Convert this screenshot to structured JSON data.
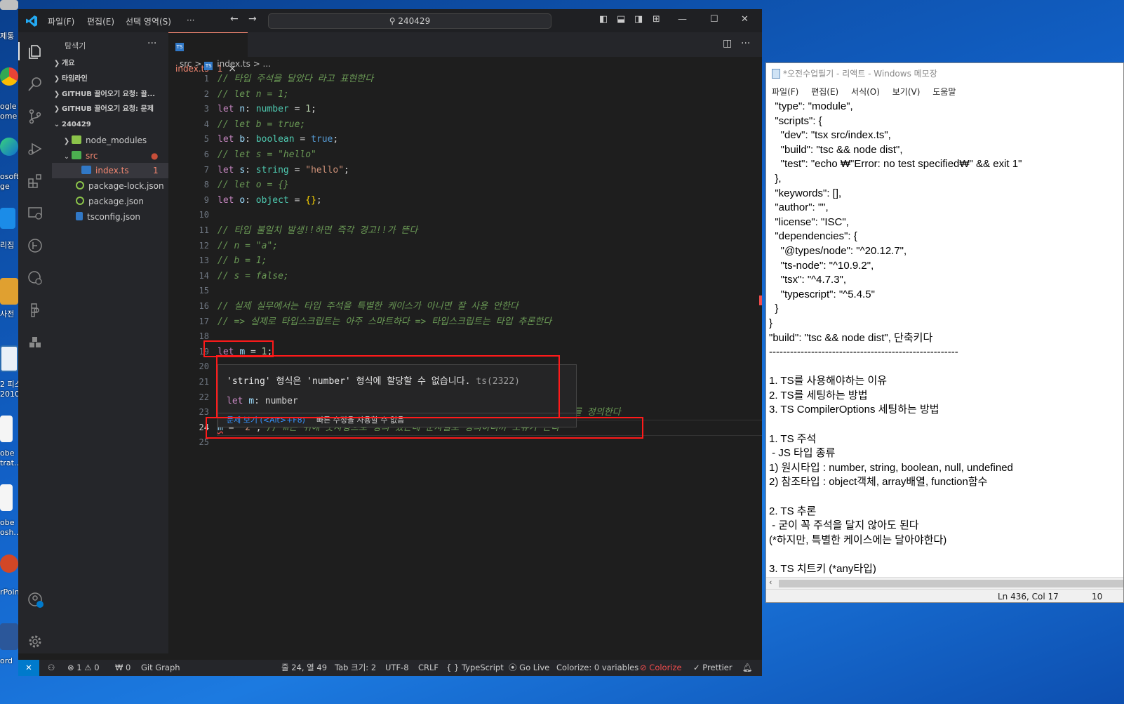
{
  "desktop": {
    "labels": [
      "제통",
      "ogle",
      "ome",
      "osoft",
      "ge",
      "리집",
      "사전",
      "2 피스",
      "2010",
      "obe",
      "trat...",
      "obe",
      "osh...",
      "rPoin",
      "ord"
    ]
  },
  "vscode": {
    "menu": [
      "파일(F)",
      "편집(E)",
      "선택 영역(S)",
      "···"
    ],
    "command_center": "240429",
    "sidebar": {
      "title": "탐색기",
      "sections": [
        "개요",
        "타임라인",
        "GITHUB 끌어오기 요청: 끌...",
        "GITHUB 끌어오기 요청: 문제",
        "240429"
      ],
      "files": [
        "node_modules",
        "src",
        "index.ts",
        "package-lock.json",
        "package.json",
        "tsconfig.json"
      ],
      "badge": "1"
    },
    "tab": {
      "label": "index.ts",
      "badge": "1",
      "close": "×"
    },
    "breadcrumb": [
      "src",
      ">",
      "index.ts",
      "> ..."
    ],
    "line_numbers": [
      "1",
      "2",
      "3",
      "4",
      "5",
      "6",
      "7",
      "8",
      "9",
      "10",
      "11",
      "12",
      "13",
      "14",
      "15",
      "16",
      "17",
      "18",
      "19",
      "20",
      "21",
      "22",
      "23",
      "24",
      "25"
    ],
    "code": {
      "l1": "// 타입 주석을 달았다 라고 표현한다",
      "l2": "// let n = 1;",
      "l3": {
        "kw": "let",
        "var": "n",
        "colon": ":",
        "type": "number",
        "eq": " = ",
        "val": "1",
        "end": ";"
      },
      "l4": "// let b = true;",
      "l5": {
        "kw": "let",
        "var": "b",
        "colon": ":",
        "type": "boolean",
        "eq": " = ",
        "val": "true",
        "end": ";"
      },
      "l6": "// let s = \"hello\"",
      "l7": {
        "kw": "let",
        "var": "s",
        "colon": ":",
        "type": "string",
        "eq": " = ",
        "val": "\"hello\"",
        "end": ";"
      },
      "l8": "// let o = {}",
      "l9": {
        "kw": "let",
        "var": "o",
        "colon": ":",
        "type": "object",
        "eq": " = ",
        "val": "{}",
        "end": ";"
      },
      "l11": "// 타입 불일치 발생!!하면 즉각 경고!!가 뜬다",
      "l12": "// n = \"a\";",
      "l13": "// b = 1;",
      "l14": "// s = false;",
      "l16": "// 실제 실무에서는 타입 주석을 특별한 케이스가 아니면 잘 사용 안한다",
      "l17": "// => 실제로 타입스크립트는 아주 스마트하다 => 타입스크립트는 타입 추론한다",
      "l19": {
        "kw": "let",
        "var": "m",
        "eq": " = ",
        "val": "1",
        "end": ";"
      },
      "l23_tail": "를 정의한다",
      "l24": {
        "var": "m",
        "eq": " = ",
        "str": "\"2\"",
        "end": "; ",
        "comment": "// m은 위에 숫자형으로 정의 했는데 문자열로 정의하니까 오류가 뜬다"
      }
    },
    "hover": {
      "message": "'string' 형식은 'number' 형식에 할당할 수 없습니다.",
      "code": "ts(2322)",
      "sig_kw": "let",
      "sig_var": "m",
      "sig_type": ": number",
      "view_problem": "문제 보기 (<Alt>+F8)",
      "no_quickfix": "빠른 수정을 사용할 수 없음"
    },
    "status": {
      "problems": "⊗ 1 ⚠ 0",
      "ports": "₩ 0",
      "git_graph": "Git Graph",
      "position": "줄 24, 열 49",
      "tab_size": "Tab 크기: 2",
      "encoding": "UTF-8",
      "eol": "CRLF",
      "language": "{ } TypeScript",
      "golive": "Go Live",
      "colorize_vars": "Colorize: 0 variables",
      "colorize": "Colorize",
      "prettier": "✓ Prettier"
    }
  },
  "notepad": {
    "title": "*오전수업필기 - 리액트 - Windows 메모장",
    "menu": [
      "파일(F)",
      "편집(E)",
      "서식(O)",
      "보기(V)",
      "도움말"
    ],
    "lines": [
      "  \"type\": \"module\",",
      "  \"scripts\": {",
      "    \"dev\": \"tsx src/index.ts\",",
      "    \"build\": \"tsc && node dist\",",
      "    \"test\": \"echo ₩\"Error: no test specified₩\" && exit 1\"",
      "  },",
      "  \"keywords\": [],",
      "  \"author\": \"\",",
      "  \"license\": \"ISC\",",
      "  \"dependencies\": {",
      "    \"@types/node\": \"^20.12.7\",",
      "    \"ts-node\": \"^10.9.2\",",
      "    \"tsx\": \"^4.7.3\",",
      "    \"typescript\": \"^5.4.5\"",
      "  }",
      "}",
      "\"build\": \"tsc && node dist\", 단축키다",
      "------------------------------------------------------",
      "",
      "1. TS를 사용해야하는 이유",
      "2. TS를 세팅하는 방법",
      "3. TS CompilerOptions 세팅하는 방법",
      "",
      "1. TS 주석",
      " - JS 타입 종류",
      "1) 원시타입 : number, string, boolean, null, undefined",
      "2) 참조타입 : object객체, array배열, function함수",
      "",
      "2. TS 추론",
      " - 굳이 꼭 주석을 달지 않아도 된다",
      "(*하지만, 특별한 케이스에는 달아야한다)",
      "",
      "3. TS 치트키 (*any타입)"
    ],
    "status_pos": "Ln 436, Col 17",
    "status_zoom": "10"
  }
}
